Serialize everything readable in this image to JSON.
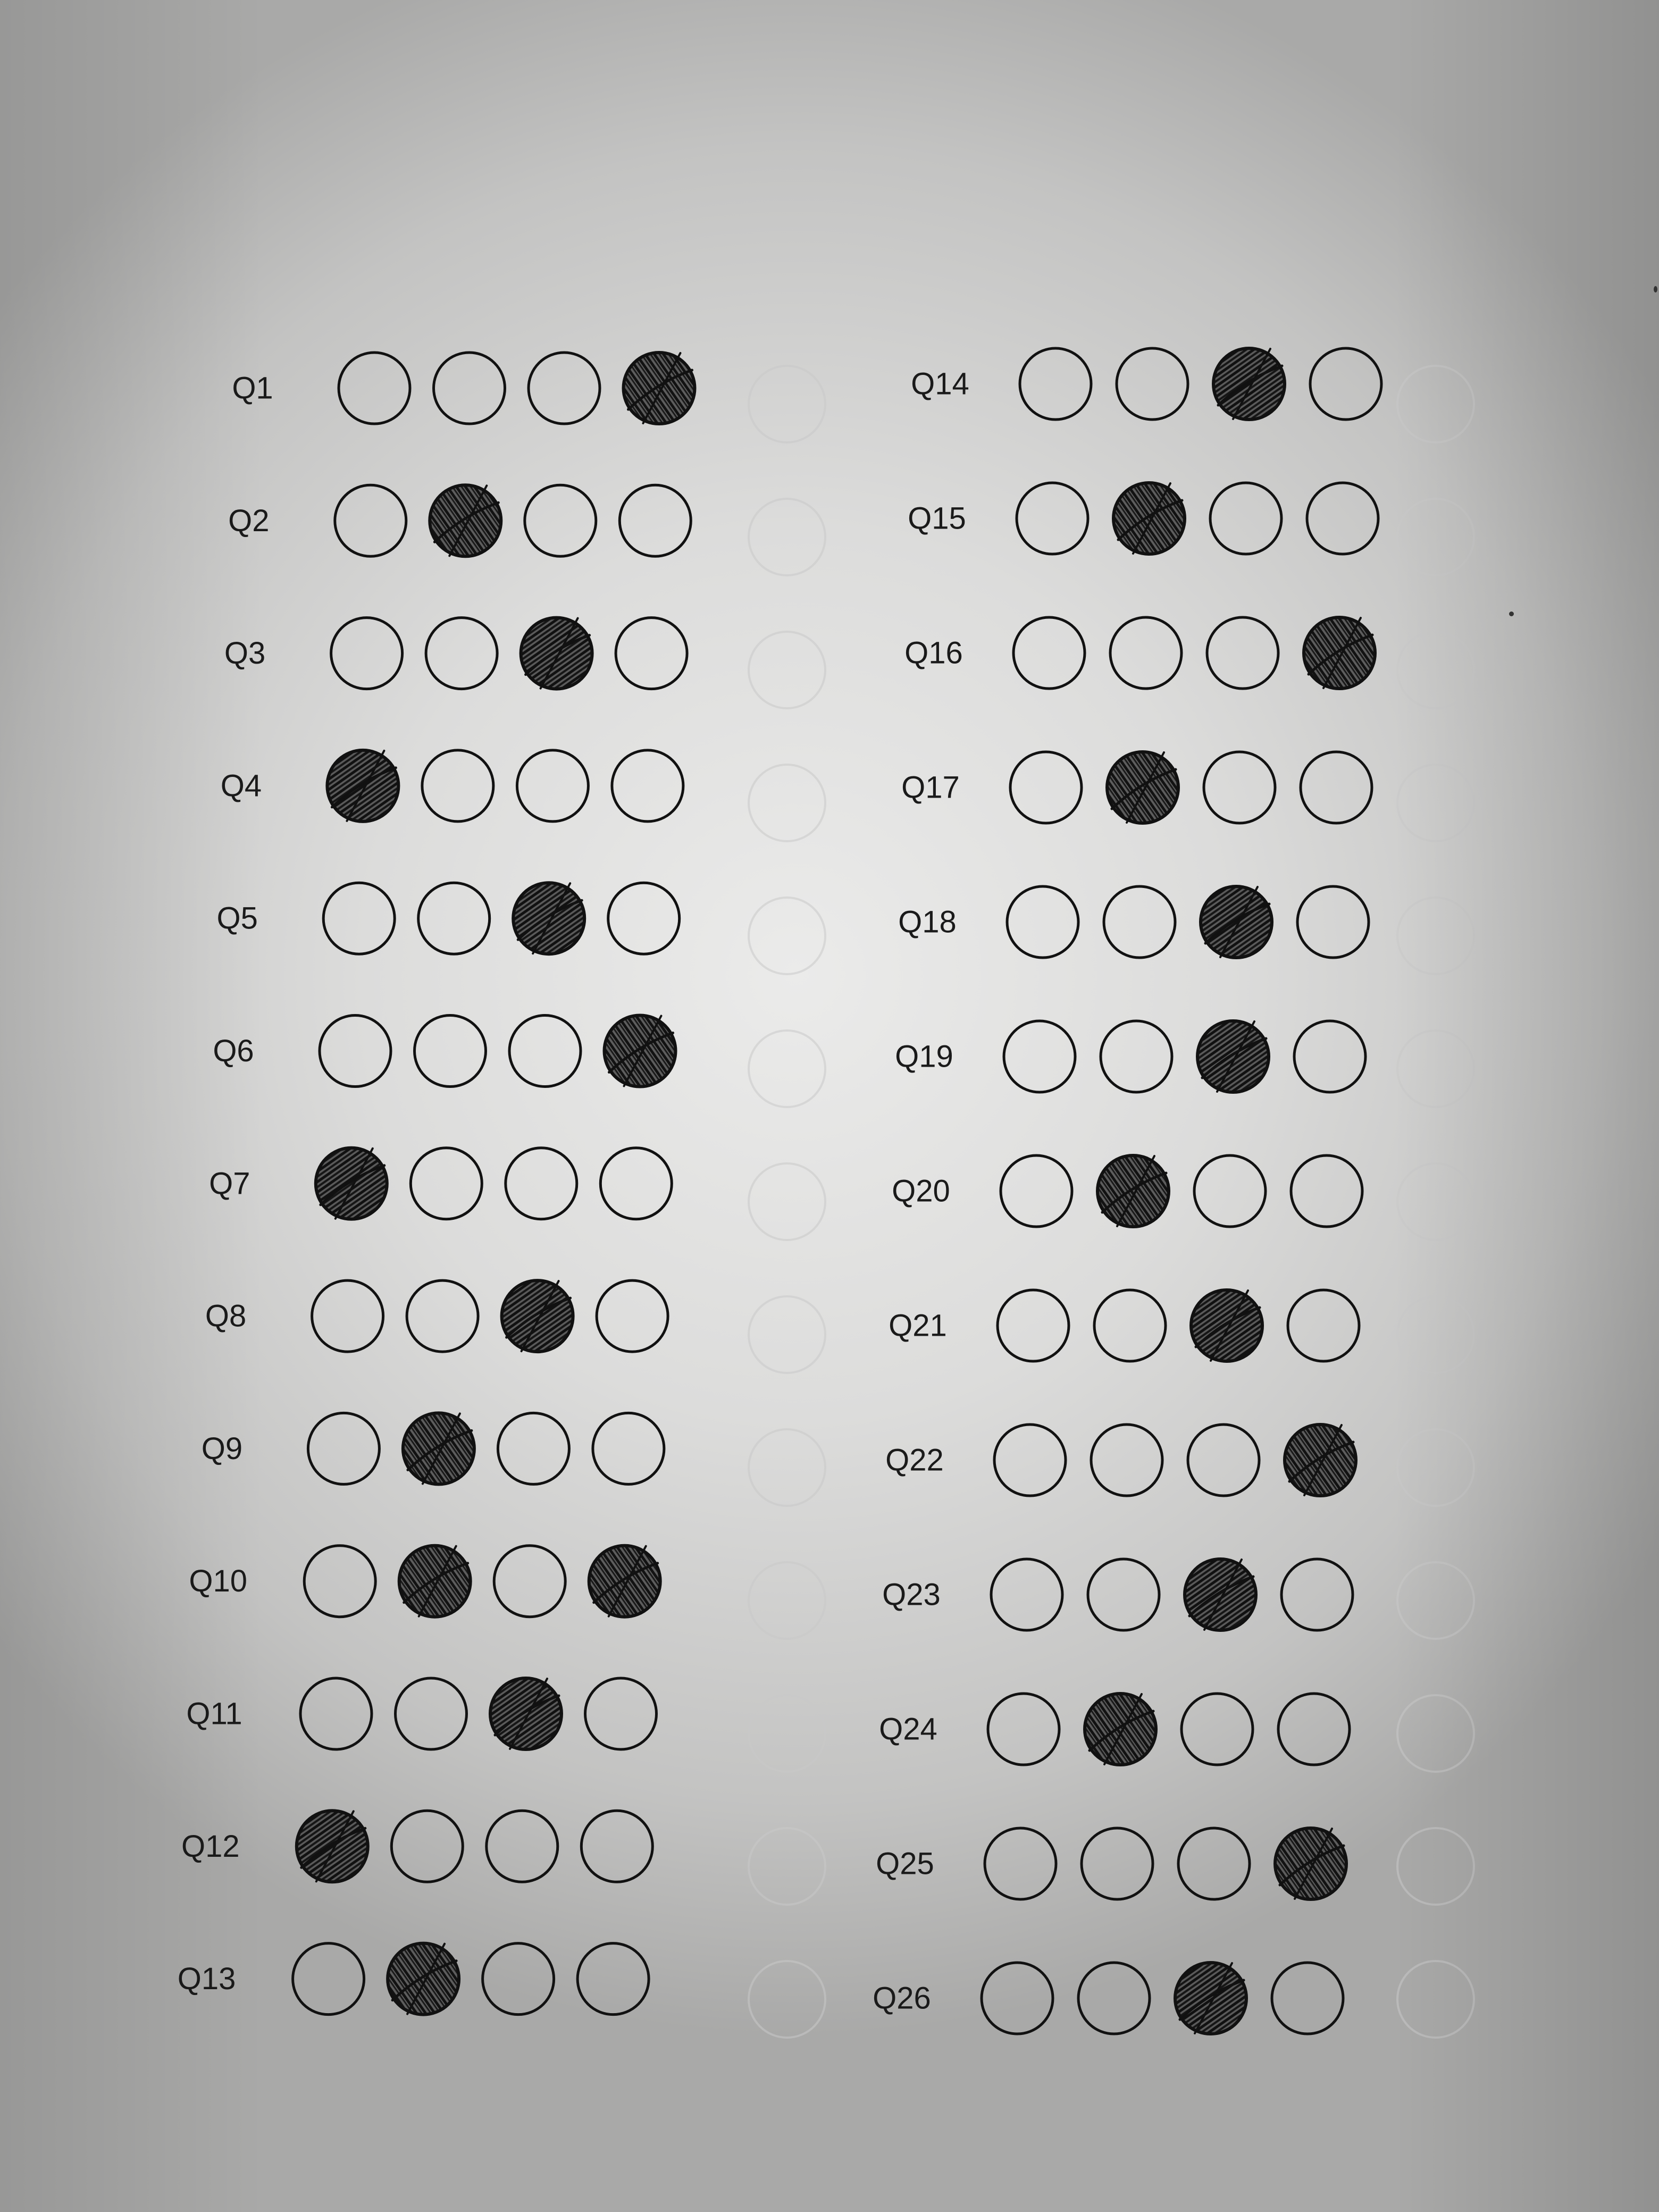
{
  "answer_sheet": {
    "options_per_question": 4,
    "left_column": [
      {
        "label": "Q1",
        "answer": 4
      },
      {
        "label": "Q2",
        "answer": 2
      },
      {
        "label": "Q3",
        "answer": 3
      },
      {
        "label": "Q4",
        "answer": 1
      },
      {
        "label": "Q5",
        "answer": 3
      },
      {
        "label": "Q6",
        "answer": 4
      },
      {
        "label": "Q7",
        "answer": 1
      },
      {
        "label": "Q8",
        "answer": 3
      },
      {
        "label": "Q9",
        "answer": 2
      },
      {
        "label": "Q10",
        "answer": [
          2,
          4
        ]
      },
      {
        "label": "Q11",
        "answer": 3
      },
      {
        "label": "Q12",
        "answer": 1
      },
      {
        "label": "Q13",
        "answer": 2
      }
    ],
    "right_column": [
      {
        "label": "Q14",
        "answer": 3
      },
      {
        "label": "Q15",
        "answer": 2
      },
      {
        "label": "Q16",
        "answer": 4
      },
      {
        "label": "Q17",
        "answer": 2
      },
      {
        "label": "Q18",
        "answer": 3
      },
      {
        "label": "Q19",
        "answer": 3
      },
      {
        "label": "Q20",
        "answer": 2
      },
      {
        "label": "Q21",
        "answer": 3
      },
      {
        "label": "Q22",
        "answer": 4
      },
      {
        "label": "Q23",
        "answer": 3
      },
      {
        "label": "Q24",
        "answer": 2
      },
      {
        "label": "Q25",
        "answer": 4
      },
      {
        "label": "Q26",
        "answer": 3
      }
    ]
  },
  "colors": {
    "ink": "#111111",
    "fill_shade": "#555555",
    "bleed_through": "#c8c8c8"
  }
}
